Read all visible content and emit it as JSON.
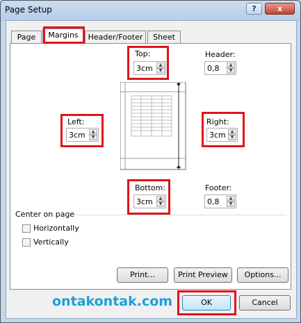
{
  "window": {
    "title": "Page Setup",
    "minimize": "–",
    "maximize": "?",
    "close": "x"
  },
  "tabs": [
    {
      "label": "Page",
      "active": false
    },
    {
      "label": "Margins",
      "active": true
    },
    {
      "label": "Header/Footer",
      "active": false
    },
    {
      "label": "Sheet",
      "active": false
    }
  ],
  "margins": {
    "top": {
      "label": "Top:",
      "value": "3cm"
    },
    "header": {
      "label": "Header:",
      "value": "0,8"
    },
    "left": {
      "label": "Left:",
      "value": "3cm"
    },
    "right": {
      "label": "Right:",
      "value": "3cm"
    },
    "bottom": {
      "label": "Bottom:",
      "value": "3cm"
    },
    "footer": {
      "label": "Footer:",
      "value": "0,8"
    }
  },
  "center_on_page": {
    "label": "Center on page",
    "horizontally": {
      "label": "Horizontally",
      "checked": false
    },
    "vertically": {
      "label": "Vertically",
      "checked": false
    }
  },
  "buttons": {
    "print": "Print...",
    "print_preview": "Print Preview",
    "options": "Options...",
    "ok": "OK",
    "cancel": "Cancel"
  },
  "watermark": "ontakontak.com",
  "colors": {
    "highlight": "#e3121b",
    "watermark": "#1aa0dc"
  }
}
